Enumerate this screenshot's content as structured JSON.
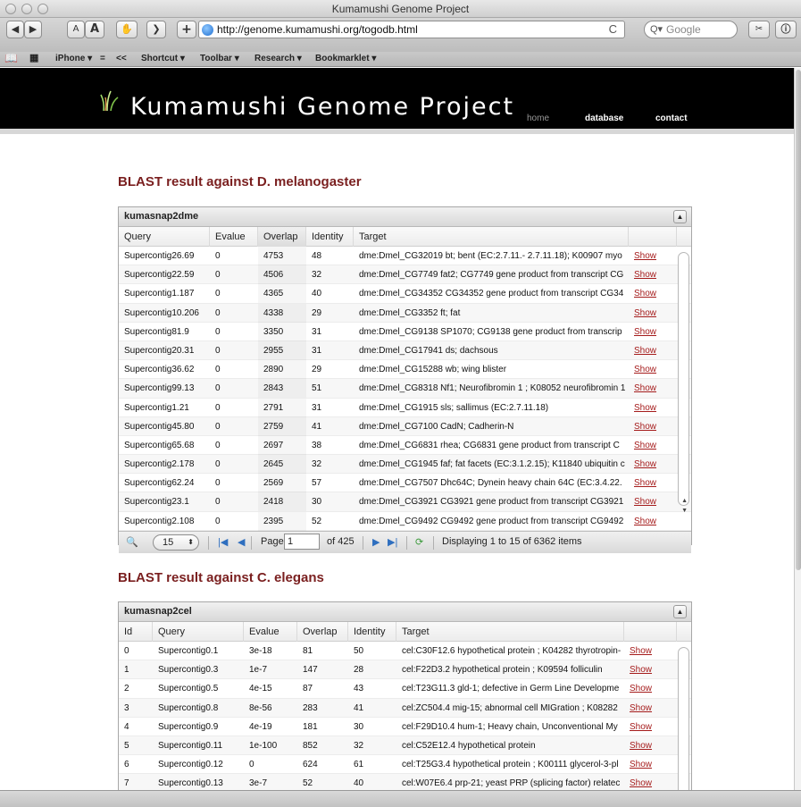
{
  "window": {
    "title": "Kumamushi Genome Project"
  },
  "toolbar": {
    "text_small": "A",
    "text_large": "A",
    "add": "+",
    "url": "http://genome.kumamushi.org/togodb.html",
    "reload": "C",
    "search_placeholder": "Google"
  },
  "bookmarks": [
    {
      "label": "iPhone ▾"
    },
    {
      "label": "="
    },
    {
      "label": "<<"
    },
    {
      "label": "Shortcut ▾"
    },
    {
      "label": "Toolbar ▾"
    },
    {
      "label": "Research ▾"
    },
    {
      "label": "Bookmarklet ▾"
    }
  ],
  "site": {
    "title": "Kumamushi Genome Project",
    "nav": {
      "home": "home",
      "database": "database",
      "contact": "contact"
    }
  },
  "section1": {
    "title": "BLAST result against D. melanogaster",
    "grid_name": "kumasnap2dme",
    "columns": [
      "Query",
      "Evalue",
      "Overlap",
      "Identity",
      "Target"
    ],
    "rows": [
      [
        "Supercontig26.69",
        "0",
        "4753",
        "48",
        "dme:Dmel_CG32019 bt; bent (EC:2.7.11.- 2.7.11.18); K00907 myo",
        "Show"
      ],
      [
        "Supercontig22.59",
        "0",
        "4506",
        "32",
        "dme:Dmel_CG7749 fat2; CG7749 gene product from transcript CG",
        "Show"
      ],
      [
        "Supercontig1.187",
        "0",
        "4365",
        "40",
        "dme:Dmel_CG34352 CG34352 gene product from transcript CG34",
        "Show"
      ],
      [
        "Supercontig10.206",
        "0",
        "4338",
        "29",
        "dme:Dmel_CG3352 ft; fat",
        "Show"
      ],
      [
        "Supercontig81.9",
        "0",
        "3350",
        "31",
        "dme:Dmel_CG9138 SP1070; CG9138 gene product from transcrip",
        "Show"
      ],
      [
        "Supercontig20.31",
        "0",
        "2955",
        "31",
        "dme:Dmel_CG17941 ds; dachsous",
        "Show"
      ],
      [
        "Supercontig36.62",
        "0",
        "2890",
        "29",
        "dme:Dmel_CG15288 wb; wing blister",
        "Show"
      ],
      [
        "Supercontig99.13",
        "0",
        "2843",
        "51",
        "dme:Dmel_CG8318 Nf1; Neurofibromin 1 ; K08052 neurofibromin 1",
        "Show"
      ],
      [
        "Supercontig1.21",
        "0",
        "2791",
        "31",
        "dme:Dmel_CG1915 sls; sallimus (EC:2.7.11.18)",
        "Show"
      ],
      [
        "Supercontig45.80",
        "0",
        "2759",
        "41",
        "dme:Dmel_CG7100 CadN; Cadherin-N",
        "Show"
      ],
      [
        "Supercontig65.68",
        "0",
        "2697",
        "38",
        "dme:Dmel_CG6831 rhea; CG6831 gene product from transcript C",
        "Show"
      ],
      [
        "Supercontig2.178",
        "0",
        "2645",
        "32",
        "dme:Dmel_CG1945 faf; fat facets (EC:3.1.2.15); K11840 ubiquitin c",
        "Show"
      ],
      [
        "Supercontig62.24",
        "0",
        "2569",
        "57",
        "dme:Dmel_CG7507 Dhc64C; Dynein heavy chain 64C (EC:3.4.22.",
        "Show"
      ],
      [
        "Supercontig23.1",
        "0",
        "2418",
        "30",
        "dme:Dmel_CG3921 CG3921 gene product from transcript CG3921",
        "Show"
      ],
      [
        "Supercontig2.108",
        "0",
        "2395",
        "52",
        "dme:Dmel_CG9492 CG9492 gene product from transcript CG9492",
        "Show"
      ]
    ],
    "pager": {
      "page_size": "15",
      "page_label": "Page",
      "page_value": "1",
      "of_label": "of 425",
      "display": "Displaying 1 to 15 of 6362 items"
    }
  },
  "section2": {
    "title": "BLAST result against C. elegans",
    "grid_name": "kumasnap2cel",
    "columns": [
      "Id",
      "Query",
      "Evalue",
      "Overlap",
      "Identity",
      "Target"
    ],
    "rows": [
      [
        "0",
        "Supercontig0.1",
        "3e-18",
        "81",
        "50",
        "cel:C30F12.6 hypothetical protein ; K04282 thyrotropin-",
        "Show"
      ],
      [
        "1",
        "Supercontig0.3",
        "1e-7",
        "147",
        "28",
        "cel:F22D3.2 hypothetical protein ; K09594 folliculin",
        "Show"
      ],
      [
        "2",
        "Supercontig0.5",
        "4e-15",
        "87",
        "43",
        "cel:T23G11.3 gld-1; defective in Germ Line Developme",
        "Show"
      ],
      [
        "3",
        "Supercontig0.8",
        "8e-56",
        "283",
        "41",
        "cel:ZC504.4 mig-15; abnormal cell MIGration ; K08282",
        "Show"
      ],
      [
        "4",
        "Supercontig0.9",
        "4e-19",
        "181",
        "30",
        "cel:F29D10.4 hum-1; Heavy chain, Unconventional My",
        "Show"
      ],
      [
        "5",
        "Supercontig0.11",
        "1e-100",
        "852",
        "32",
        "cel:C52E12.4 hypothetical protein",
        "Show"
      ],
      [
        "6",
        "Supercontig0.12",
        "0",
        "624",
        "61",
        "cel:T25G3.4 hypothetical protein ; K00111 glycerol-3-pl",
        "Show"
      ],
      [
        "7",
        "Supercontig0.13",
        "3e-7",
        "52",
        "40",
        "cel:W07E6.4 prp-21; yeast PRP (splicing factor) relatec",
        "Show"
      ]
    ]
  }
}
